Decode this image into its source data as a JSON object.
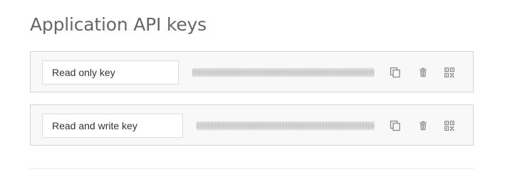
{
  "section": {
    "title": "Application API keys"
  },
  "keys": [
    {
      "name": "Read only key",
      "actions": {
        "copy_icon": "copy-icon",
        "delete_icon": "trash-icon",
        "qr_icon": "qr-code-icon"
      }
    },
    {
      "name": "Read and write key",
      "actions": {
        "copy_icon": "copy-icon",
        "delete_icon": "trash-icon",
        "qr_icon": "qr-code-icon"
      }
    }
  ],
  "colors": {
    "title": "#666666",
    "row_background": "#f8f8f8",
    "row_border": "#d5d5d5",
    "icon": "#8a8a8a"
  }
}
